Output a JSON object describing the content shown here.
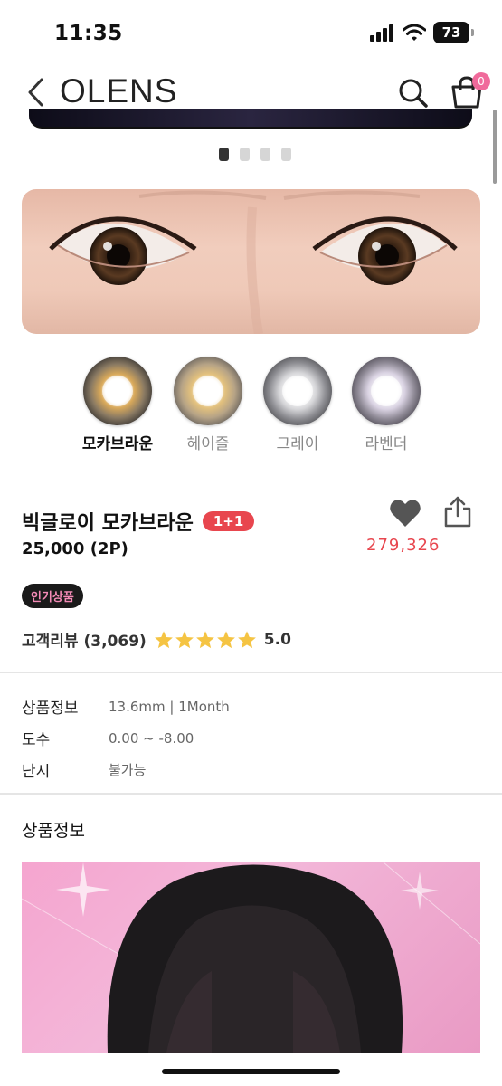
{
  "status_bar": {
    "time": "11:35",
    "battery": "73"
  },
  "header": {
    "logo": "OLENS",
    "cart_count": "0"
  },
  "gallery": {
    "dots": 4,
    "active_index": 0
  },
  "color_options": [
    {
      "label": "모카브라운",
      "selected": true,
      "swatch_color": "#8a7a63",
      "ring_color": "#d7a85b"
    },
    {
      "label": "헤이즐",
      "selected": false,
      "swatch_color": "#b6a386",
      "ring_color": "#e1c07a"
    },
    {
      "label": "그레이",
      "selected": false,
      "swatch_color": "#8d8d92",
      "ring_color": "#c8c8cc"
    },
    {
      "label": "라벤더",
      "selected": false,
      "swatch_color": "#8f8a96",
      "ring_color": "#cfc8d8"
    }
  ],
  "product": {
    "name": "빅글로이 모카브라운",
    "promo_badge": "1+1",
    "price": "25,000 (2P)",
    "like_count": "279,326",
    "popular_badge": "인기상품",
    "review_label": "고객리뷰 (3,069)",
    "rating": "5.0",
    "star_count": 5
  },
  "specs": [
    {
      "key": "상품정보",
      "value": "13.6mm | 1Month"
    },
    {
      "key": "도수",
      "value": "0.00 ~ -8.00"
    },
    {
      "key": "난시",
      "value": "불가능"
    }
  ],
  "section_title": "상품정보",
  "colors": {
    "accent_red": "#e8464e",
    "badge_pink": "#f06a9b"
  }
}
